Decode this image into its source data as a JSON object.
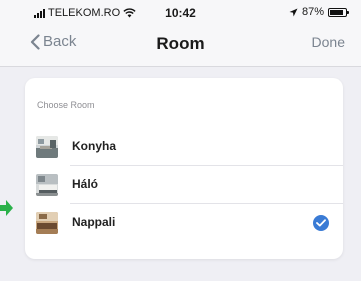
{
  "status_bar": {
    "carrier": "TELEKOM.RO",
    "time": "10:42",
    "battery_percent": "87%",
    "battery_level": 0.87,
    "icons": [
      "signal-bars-icon",
      "wifi-icon",
      "location-arrow-icon",
      "battery-icon"
    ]
  },
  "nav": {
    "back_label": "Back",
    "title": "Room",
    "done_label": "Done",
    "back_icon": "chevron-left-icon"
  },
  "section": {
    "header": "Choose Room"
  },
  "rooms": [
    {
      "name": "Konyha",
      "selected": false,
      "thumb_icon": "kitchen-photo-icon"
    },
    {
      "name": "Háló",
      "selected": false,
      "thumb_icon": "bedroom-photo-icon"
    },
    {
      "name": "Nappali",
      "selected": true,
      "thumb_icon": "living-room-photo-icon"
    }
  ],
  "colors": {
    "accent": "#3a7bd5",
    "nav_text": "#7b8490",
    "background": "#efeff4",
    "pointer": "#2bb14a"
  }
}
